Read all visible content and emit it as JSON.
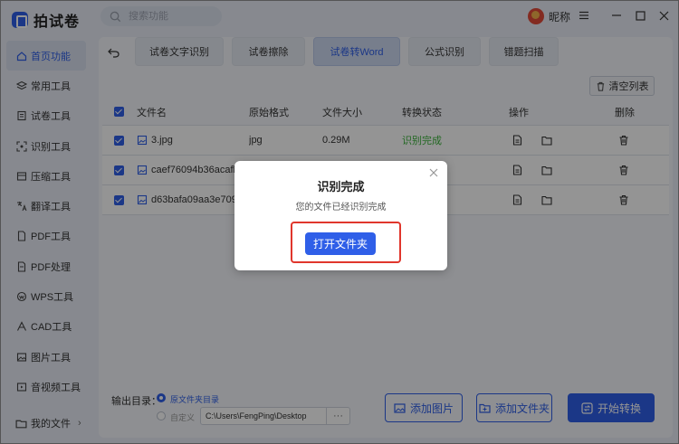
{
  "app": {
    "name": "拍试卷"
  },
  "search": {
    "placeholder": "搜索功能"
  },
  "user": {
    "name": "昵称"
  },
  "sidebar": {
    "items": [
      {
        "label": "首页功能",
        "icon": "home-icon",
        "active": true
      },
      {
        "label": "常用工具",
        "icon": "layers-icon"
      },
      {
        "label": "试卷工具",
        "icon": "paper-icon"
      },
      {
        "label": "识别工具",
        "icon": "scan-icon"
      },
      {
        "label": "压缩工具",
        "icon": "compress-icon"
      },
      {
        "label": "翻译工具",
        "icon": "translate-icon"
      },
      {
        "label": "PDF工具",
        "icon": "pdf-icon"
      },
      {
        "label": "PDF处理",
        "icon": "pdf-process-icon"
      },
      {
        "label": "WPS工具",
        "icon": "wps-icon"
      },
      {
        "label": "CAD工具",
        "icon": "cad-icon"
      },
      {
        "label": "图片工具",
        "icon": "image-icon"
      },
      {
        "label": "音视频工具",
        "icon": "video-icon"
      }
    ],
    "my_files": "我的文件"
  },
  "tabs": [
    {
      "label": "试卷文字识别"
    },
    {
      "label": "试卷擦除"
    },
    {
      "label": "试卷转Word",
      "active": true
    },
    {
      "label": "公式识别"
    },
    {
      "label": "错题扫描"
    }
  ],
  "toolbar": {
    "clear_label": "清空列表"
  },
  "table": {
    "headers": {
      "name": "文件名",
      "format": "原始格式",
      "size": "文件大小",
      "status": "转换状态",
      "ops": "操作",
      "delete": "删除"
    },
    "rows": [
      {
        "name": "3.jpg",
        "format": "jpg",
        "size": "0.29M",
        "status": "识别完成"
      },
      {
        "name": "caef76094b36acafb...",
        "format": "",
        "size": "",
        "status": ""
      },
      {
        "name": "d63bafa09aa3e7096...",
        "format": "",
        "size": "",
        "status": ""
      }
    ]
  },
  "output": {
    "label": "输出目录：",
    "option_source": "原文件夹目录",
    "option_custom": "自定义",
    "path": "C:\\Users\\FengPing\\Desktop",
    "browse": "···"
  },
  "actions": {
    "add_image": "添加图片",
    "add_folder": "添加文件夹",
    "start": "开始转换"
  },
  "modal": {
    "title": "识别完成",
    "message": "您的文件已经识别完成",
    "button": "打开文件夹"
  },
  "colors": {
    "accent": "#2f5fe8",
    "success": "#3bb33b",
    "highlight": "#e0362c"
  }
}
